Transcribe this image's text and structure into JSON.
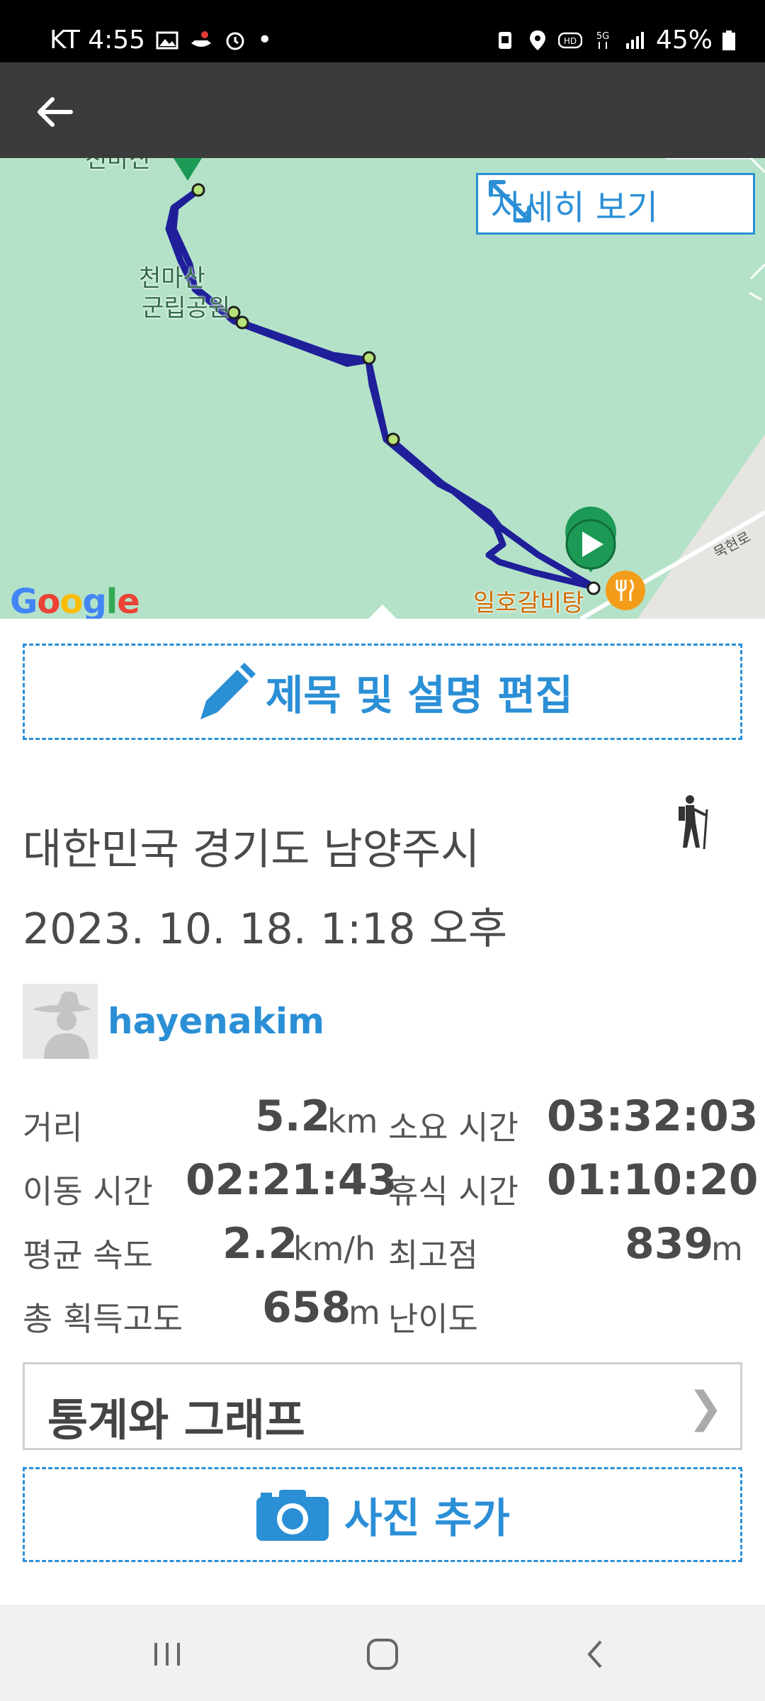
{
  "status_bar": {
    "carrier_time": "KT 4:55",
    "dot": "•",
    "battery": "45%",
    "icons": [
      "image-icon",
      "boat-icon",
      "alarm-icon",
      "recycle-icon",
      "location-icon",
      "hd-icon",
      "5g-icon",
      "signal-icon",
      "battery-icon"
    ]
  },
  "app_bar": {
    "back_icon": "back-arrow-icon"
  },
  "map": {
    "detail_button": "자세히 보기",
    "park_label_line1": "천마산",
    "park_label_line2": "군립공원",
    "top_label": "천마산",
    "poi_label": "일호갈비탕",
    "road_label": "묵현로",
    "google_logo": "Google"
  },
  "edit": {
    "label": "제목 및 설명 편집"
  },
  "trip": {
    "location": "대한민국 경기도 남양주시",
    "datetime": "2023. 10. 18. 1:18 오후",
    "activity_icon": "hiker-icon"
  },
  "user": {
    "name": "hayenakim"
  },
  "stats": {
    "distance_label": "거리",
    "distance_value": "5.2",
    "distance_unit": "km",
    "duration_label": "소요 시간",
    "duration_value": "03:32:03",
    "moving_label": "이동 시간",
    "moving_value": "02:21:43",
    "rest_label": "휴식 시간",
    "rest_value": "01:10:20",
    "avg_speed_label": "평균 속도",
    "avg_speed_value": "2.2",
    "avg_speed_unit": "km/h",
    "max_elev_label": "최고점",
    "max_elev_value": "839",
    "max_elev_unit": "m",
    "gain_label": "총 획득고도",
    "gain_value": "658",
    "gain_unit": "m",
    "difficulty_label": "난이도"
  },
  "graph_button": {
    "label": "통계와 그래프",
    "chevron": "❯"
  },
  "photo_button": {
    "label": "사진 추가"
  },
  "colors": {
    "accent": "#2b8fd6",
    "track": "#1f1f99",
    "map_green": "#b4e2c8",
    "appbar": "#3b3b3b"
  }
}
